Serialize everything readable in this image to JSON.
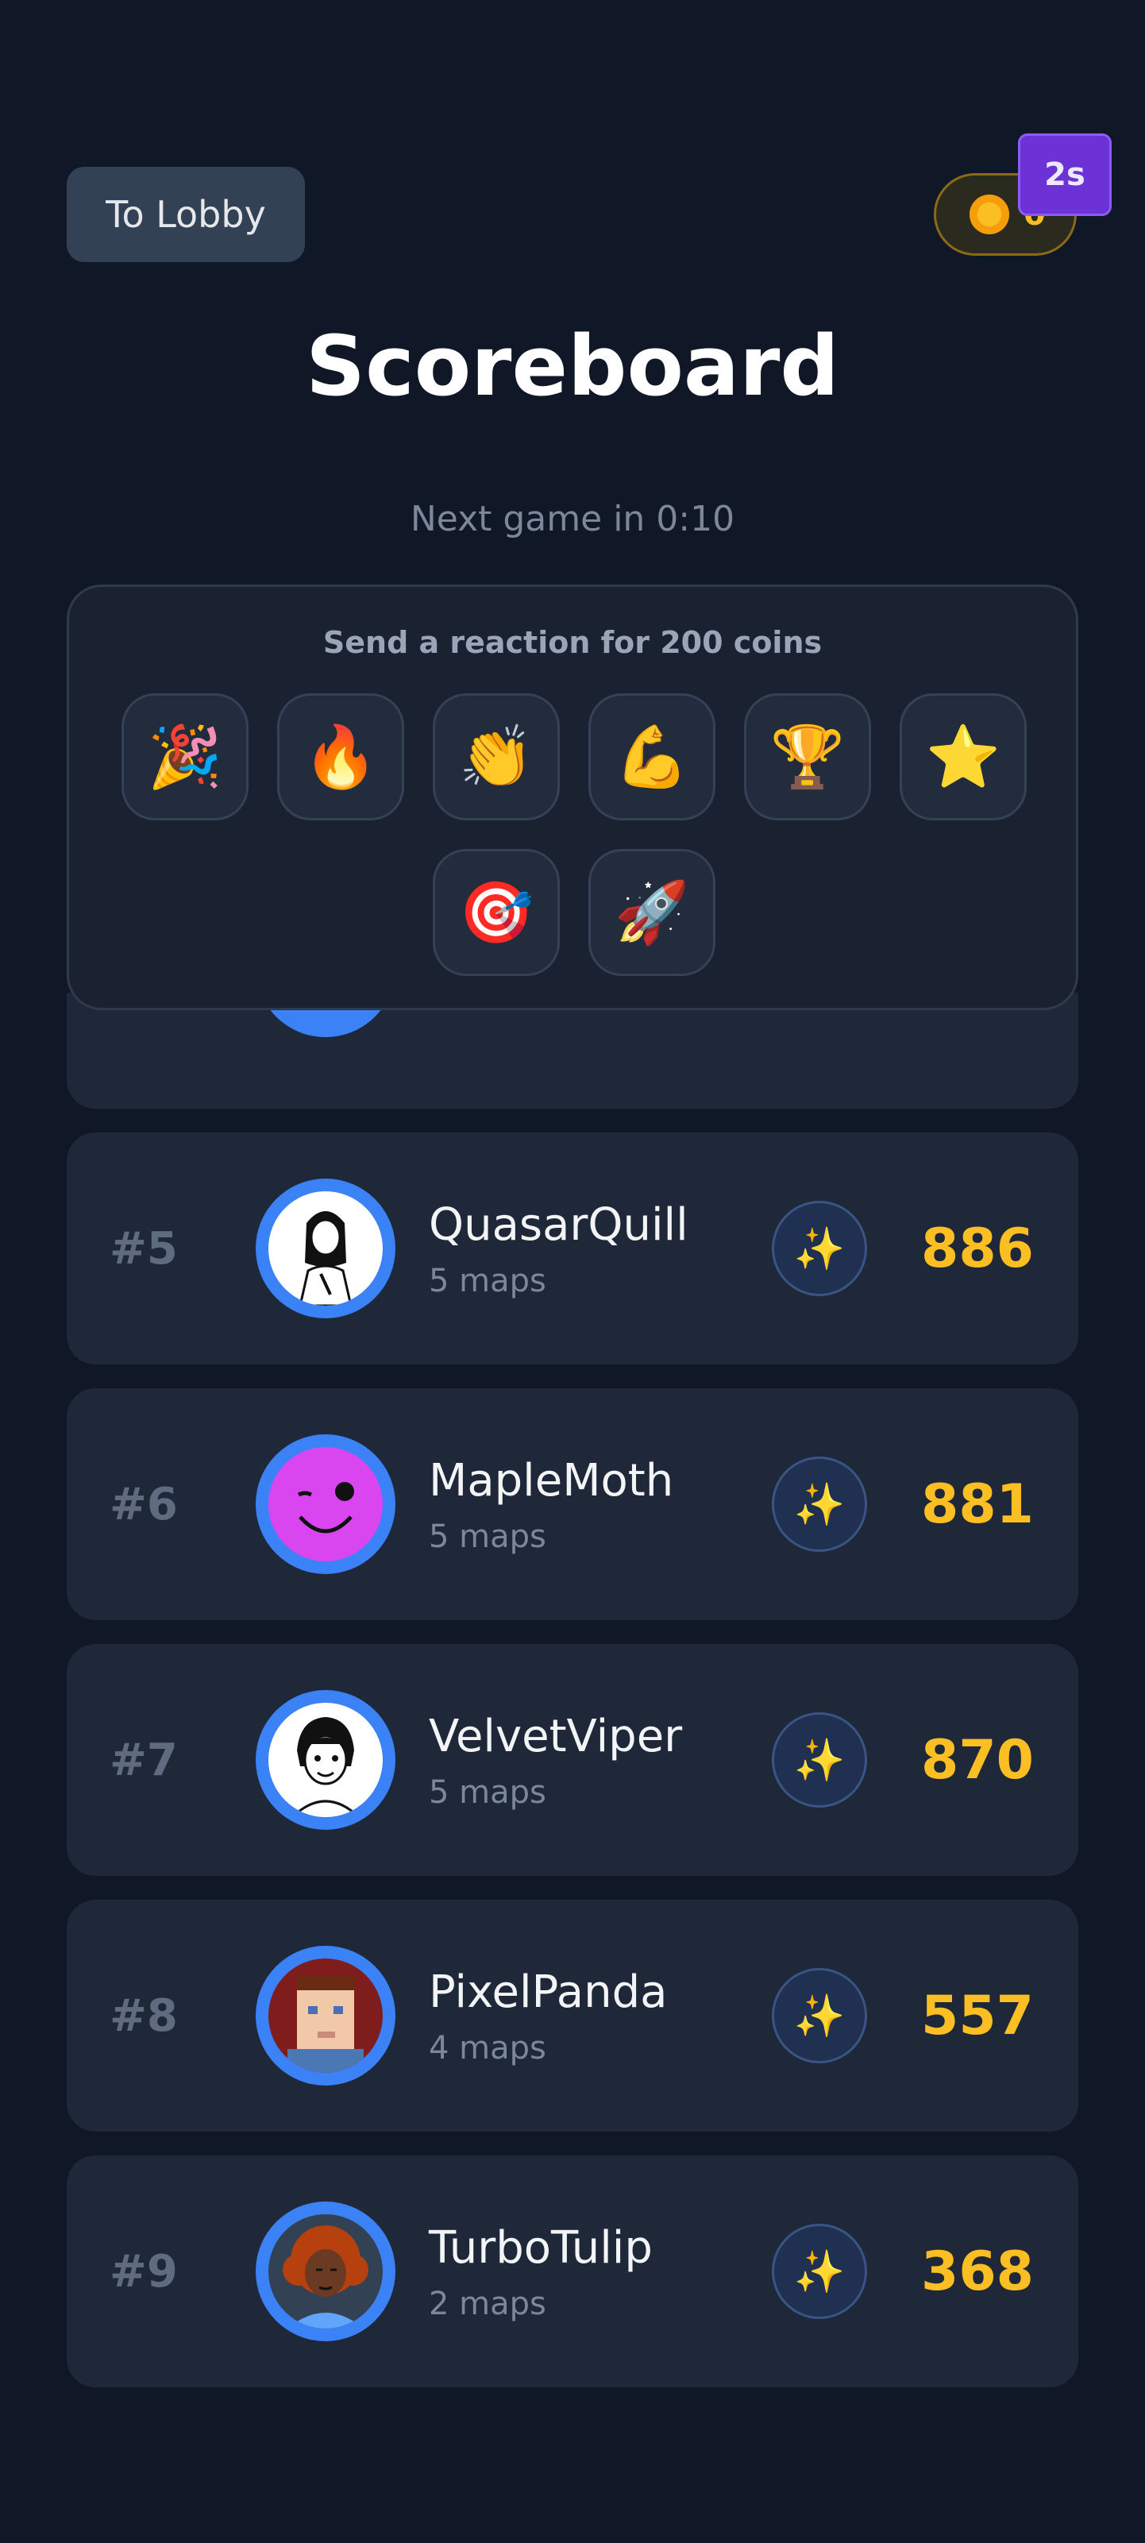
{
  "header": {
    "lobby_button_label": "To Lobby",
    "coins": "0",
    "timer_badge": "2s"
  },
  "title": "Scoreboard",
  "next_game_text": "Next game in 0:10",
  "reactions": {
    "title": "Send a reaction for 200 coins",
    "emojis": [
      "🎉",
      "🔥",
      "👏",
      "💪",
      "🏆",
      "⭐",
      "🎯",
      "🚀"
    ]
  },
  "players": [
    {
      "rank": "#5",
      "name": "QuasarQuill",
      "maps": "5 maps",
      "score": "886",
      "reaction": "✨"
    },
    {
      "rank": "#6",
      "name": "MapleMoth",
      "maps": "5 maps",
      "score": "881",
      "reaction": "✨"
    },
    {
      "rank": "#7",
      "name": "VelvetViper",
      "maps": "5 maps",
      "score": "870",
      "reaction": "✨"
    },
    {
      "rank": "#8",
      "name": "PixelPanda",
      "maps": "4 maps",
      "score": "557",
      "reaction": "✨"
    },
    {
      "rank": "#9",
      "name": "TurboTulip",
      "maps": "2 maps",
      "score": "368",
      "reaction": "✨"
    }
  ],
  "colors": {
    "background": "#101727",
    "accent_blue": "#3b82f6",
    "score_gold": "#fbbf24",
    "timer_purple": "#6d32d6"
  }
}
